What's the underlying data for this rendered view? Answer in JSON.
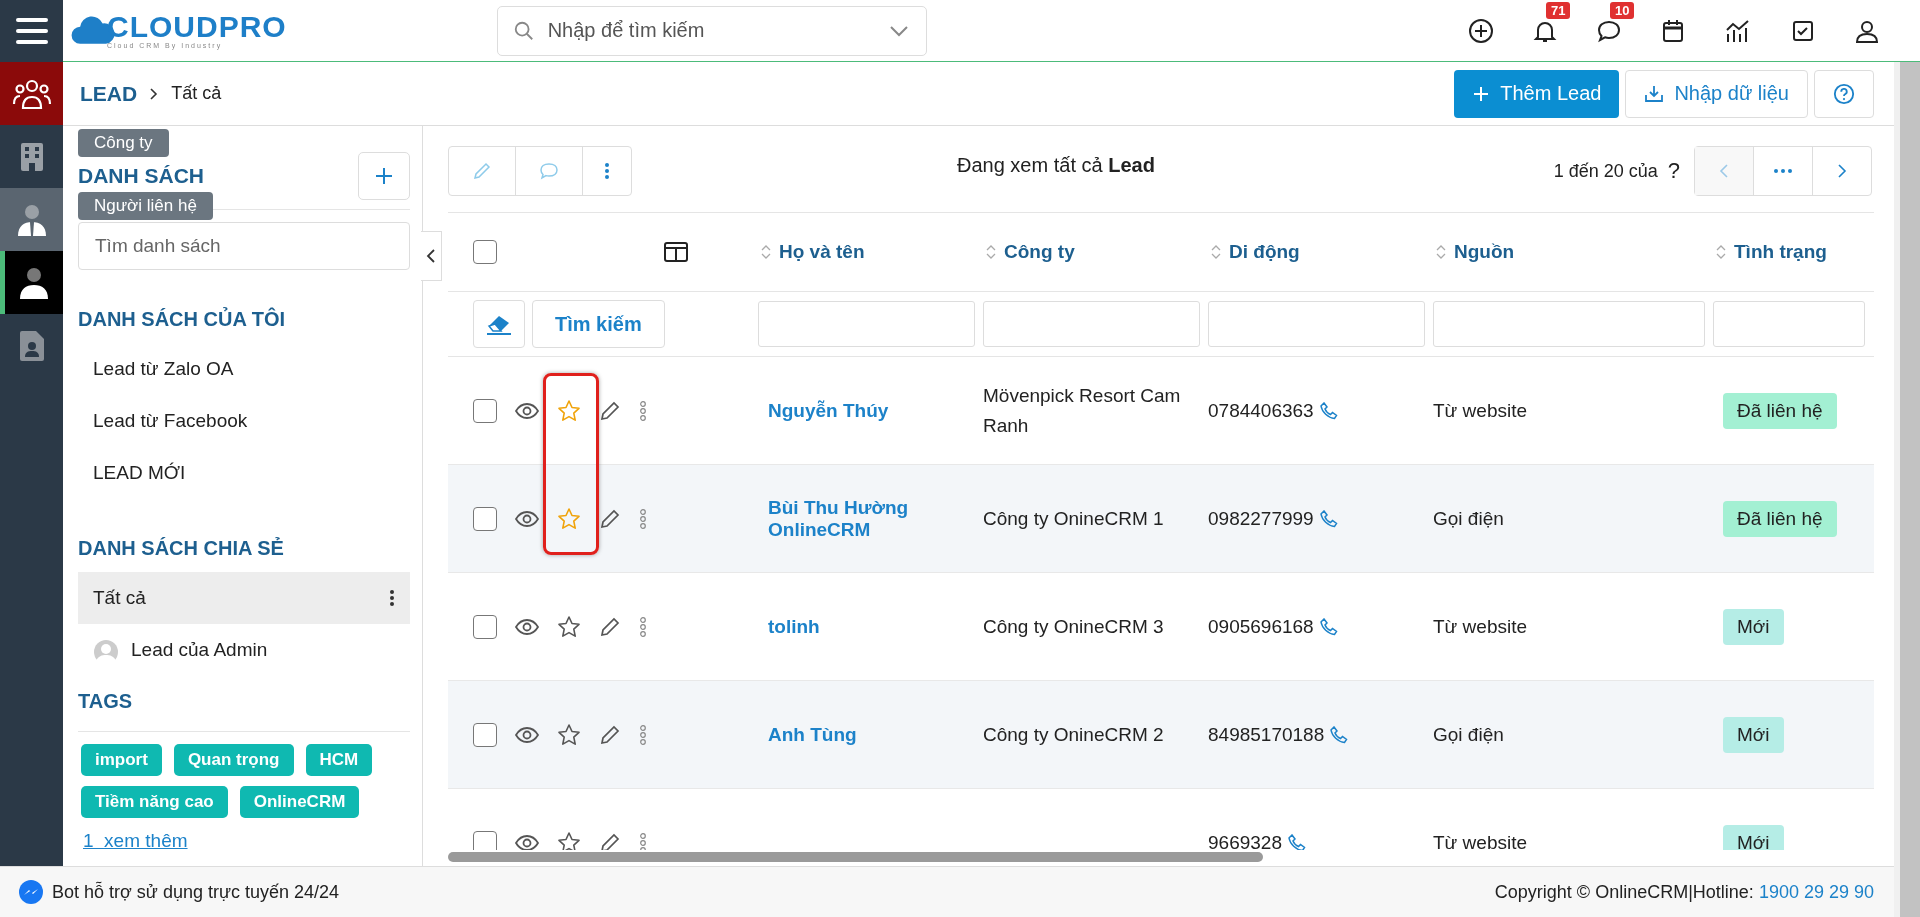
{
  "topbar": {
    "logo": "CLOUDPRO",
    "logo_tagline": "Cloud CRM By Industry",
    "search": {
      "placeholder": "Nhập để tìm kiếm"
    },
    "icons": [
      {
        "kind": "add"
      },
      {
        "kind": "bell",
        "badge": "71"
      },
      {
        "kind": "chat",
        "badge": "10"
      },
      {
        "kind": "calendar"
      },
      {
        "kind": "chart"
      },
      {
        "kind": "task"
      },
      {
        "kind": "user"
      }
    ]
  },
  "rail": [
    {
      "kind": "leads",
      "selected": true,
      "hovered": false
    },
    {
      "kind": "building",
      "selected": false,
      "hovered": false,
      "tooltip": "Công ty"
    },
    {
      "kind": "contact",
      "selected": false,
      "hovered": true,
      "tooltip": "Người liên hệ"
    },
    {
      "kind": "person",
      "selected": false,
      "hovered": false,
      "current": true
    },
    {
      "kind": "document",
      "selected": false,
      "hovered": false
    }
  ],
  "breadcrumb": {
    "module": "LEAD",
    "current": "Tất cả"
  },
  "actions": {
    "add": "Thêm Lead",
    "import": "Nhập dữ liệu"
  },
  "sidebar": {
    "title": "DANH SÁCH",
    "search": {
      "placeholder": "Tìm danh sách"
    },
    "my_lists_title": "DANH SÁCH CỦA TÔI",
    "my_lists": [
      {
        "label": "Lead từ Zalo OA",
        "selected": false
      },
      {
        "label": "Lead từ Facebook",
        "selected": false
      },
      {
        "label": "LEAD MỚI",
        "selected": false
      }
    ],
    "shared_title": "DANH SÁCH CHIA SẺ",
    "shared": [
      {
        "label": "Tất cả",
        "selected": true,
        "kind": "plain"
      },
      {
        "label": "Lead của Admin",
        "selected": false,
        "kind": "owner"
      }
    ],
    "tags_title": "TAGS",
    "tags": [
      "import",
      "Quan trọng",
      "HCM",
      "Tiềm năng cao",
      "OnlineCRM"
    ],
    "more": "1  xem thêm"
  },
  "table": {
    "view_label": "Đang xem tất cả ",
    "view_bold": "Lead",
    "pager": "1 đến 20 của",
    "pager_total": "?",
    "search_button": "Tìm kiếm",
    "all_checked": false,
    "columns": [
      "Họ và tên",
      "Công ty",
      "Di động",
      "Nguồn",
      "Tình trạng"
    ],
    "highlight_stars": true,
    "rows": [
      {
        "name": "Nguyễn Thúy",
        "company": "Mövenpick Resort Cam Ranh",
        "phone": "0784406363",
        "source": "Từ website",
        "status": "Đã liên hệ",
        "color": "#a3f0d3",
        "starred": true,
        "checked": false,
        "shaded": false
      },
      {
        "name": "Bùi Thu Hường OnlineCRM",
        "company": "Công ty OnineCRM 1",
        "phone": "0982277999",
        "source": "Gọi điện",
        "status": "Đã liên hệ",
        "color": "#a3f0d3",
        "starred": true,
        "checked": false,
        "shaded": true
      },
      {
        "name": "tolinh",
        "company": "Công ty OnineCRM 3",
        "phone": "0905696168",
        "source": "Từ website",
        "status": "Mới",
        "color": "#b5ede6",
        "starred": false,
        "checked": false,
        "shaded": false
      },
      {
        "name": "Anh Tùng",
        "company": "Công ty OnineCRM 2",
        "phone": "84985170188",
        "source": "Gọi điện",
        "status": "Mới",
        "color": "#b5ede6",
        "starred": false,
        "checked": false,
        "shaded": true
      },
      {
        "phone": "9669328",
        "source": "Từ website",
        "status": "Mới",
        "color": "#b5ede6",
        "starred": false,
        "checked": false,
        "shaded": false
      }
    ]
  },
  "footer": {
    "bot": "Bot hỗ trợ sử dụng trực tuyến 24/24",
    "copyright": "Copyright © OnlineCRM|Hotline: ",
    "hotline": "1900 29 29 90"
  }
}
